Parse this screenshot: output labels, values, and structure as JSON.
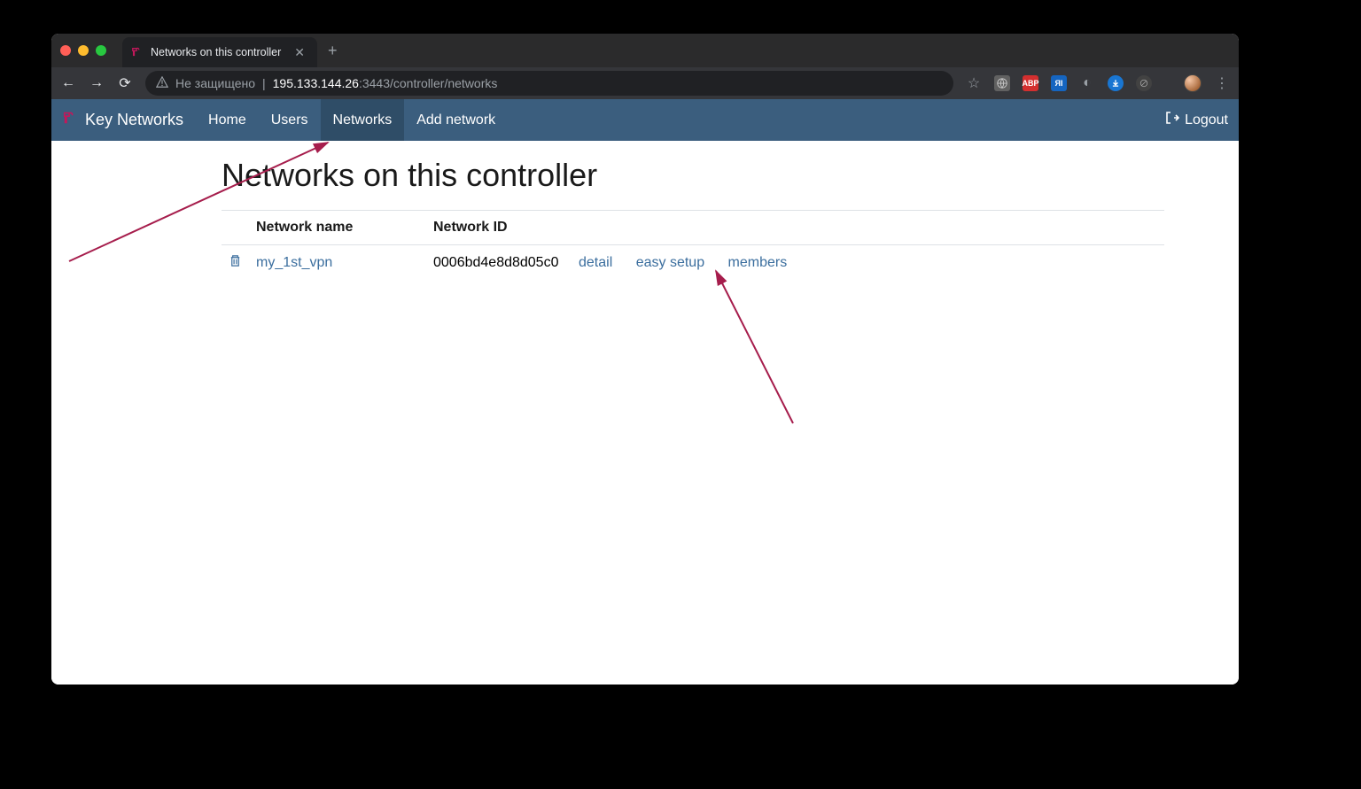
{
  "browser": {
    "tab_title": "Networks on this controller",
    "security_label": "Не защищено",
    "url_host": "195.133.144.26",
    "url_path": ":3443/controller/networks"
  },
  "navbar": {
    "brand": "Key Networks",
    "links": [
      "Home",
      "Users",
      "Networks",
      "Add network"
    ],
    "active_index": 2,
    "logout": "Logout"
  },
  "page": {
    "heading": "Networks on this controller",
    "columns": [
      "Network name",
      "Network ID"
    ],
    "rows": [
      {
        "name": "my_1st_vpn",
        "id": "0006bd4e8d8d05c0",
        "actions": [
          "detail",
          "easy setup",
          "members"
        ]
      }
    ]
  }
}
